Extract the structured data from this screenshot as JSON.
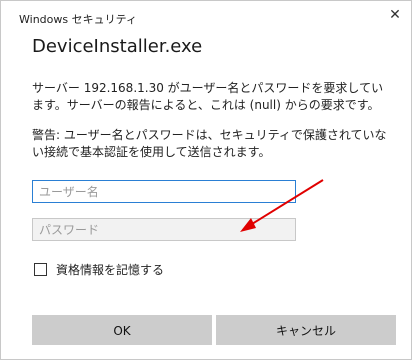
{
  "window": {
    "title": "Windows セキュリティ",
    "close_glyph": "✕"
  },
  "app_name": "DeviceInstaller.exe",
  "message": "サーバー 192.168.1.30 がユーザー名とパスワードを要求しています。サーバーの報告によると、これは (null) からの要求です。",
  "warning": "警告: ユーザー名とパスワードは、セキュリティで保護されていない接続で基本認証を使用して送信されます。",
  "username": {
    "placeholder": "ユーザー名",
    "value": ""
  },
  "password": {
    "placeholder": "パスワード",
    "value": ""
  },
  "remember": {
    "label": "資格情報を記憶する",
    "checked": false
  },
  "buttons": {
    "ok": "OK",
    "cancel": "キャンセル"
  },
  "annotation": {
    "arrow_color": "#e00000"
  }
}
